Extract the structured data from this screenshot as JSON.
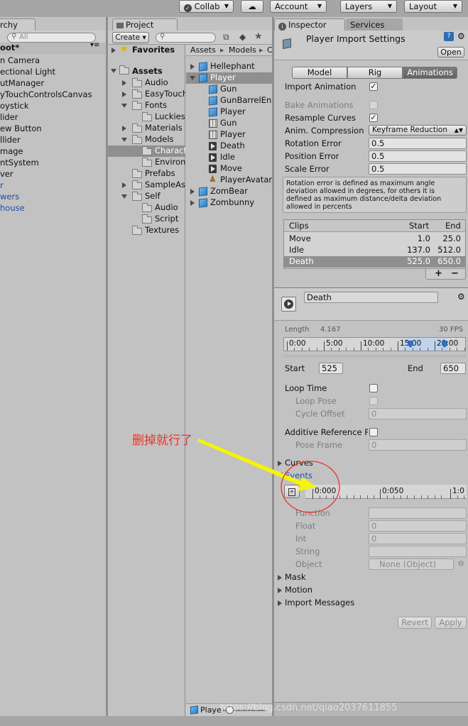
{
  "toolbar": {
    "collab": "Collab",
    "account": "Account",
    "layers": "Layers",
    "layout": "Layout"
  },
  "hierarchy": {
    "tab": "rchy",
    "scene": "oot*",
    "items": [
      "n Camera",
      "ectional Light",
      "utManager",
      "yTouchControlsCanvas",
      "oystick",
      "lider",
      "ew Button",
      "llider",
      "mage",
      "ntSystem",
      "ver",
      "r",
      "wers",
      "house"
    ],
    "blue_items": [
      11,
      12,
      13
    ]
  },
  "project": {
    "tab": "Project",
    "create": "Create",
    "search_placeholder": "",
    "favorites": "Favorites",
    "assets": "Assets",
    "tree": [
      {
        "label": "Audio",
        "depth": 1,
        "arrow": "right"
      },
      {
        "label": "EasyTouch",
        "depth": 1,
        "arrow": "right"
      },
      {
        "label": "Fonts",
        "depth": 1,
        "arrow": "down"
      },
      {
        "label": "Luckiest",
        "depth": 2,
        "arrow": ""
      },
      {
        "label": "Materials",
        "depth": 1,
        "arrow": "right"
      },
      {
        "label": "Models",
        "depth": 1,
        "arrow": "down"
      },
      {
        "label": "Characte",
        "depth": 2,
        "arrow": "",
        "selected": true
      },
      {
        "label": "Environn",
        "depth": 2,
        "arrow": ""
      },
      {
        "label": "Prefabs",
        "depth": 1,
        "arrow": ""
      },
      {
        "label": "SampleAss",
        "depth": 1,
        "arrow": "right"
      },
      {
        "label": "Self",
        "depth": 1,
        "arrow": "down"
      },
      {
        "label": "Audio",
        "depth": 2,
        "arrow": ""
      },
      {
        "label": "Script",
        "depth": 2,
        "arrow": ""
      },
      {
        "label": "Textures",
        "depth": 1,
        "arrow": ""
      }
    ],
    "breadcrumb": [
      "Assets",
      "Models",
      "C"
    ],
    "files": [
      {
        "label": "Hellephant",
        "icon": "cube",
        "depth": 0,
        "arrow": "right"
      },
      {
        "label": "Player",
        "icon": "cube",
        "depth": 0,
        "arrow": "down",
        "selected": true
      },
      {
        "label": "Gun",
        "icon": "cube",
        "depth": 1
      },
      {
        "label": "GunBarrelEn",
        "icon": "cube",
        "depth": 1
      },
      {
        "label": "Player",
        "icon": "cube",
        "depth": 1
      },
      {
        "label": "Gun",
        "icon": "grid",
        "depth": 1
      },
      {
        "label": "Player",
        "icon": "grid",
        "depth": 1
      },
      {
        "label": "Death",
        "icon": "anim",
        "depth": 1
      },
      {
        "label": "Idle",
        "icon": "anim",
        "depth": 1
      },
      {
        "label": "Move",
        "icon": "anim",
        "depth": 1
      },
      {
        "label": "PlayerAvatar",
        "icon": "avatar",
        "depth": 1
      },
      {
        "label": "ZomBear",
        "icon": "cube",
        "depth": 0,
        "arrow": "right"
      },
      {
        "label": "Zombunny",
        "icon": "cube",
        "depth": 0,
        "arrow": "right"
      }
    ],
    "bottom_label": "Playe"
  },
  "inspector": {
    "tab": "Inspector",
    "services_tab": "Services",
    "title": "Player Import Settings",
    "open": "Open",
    "tabs": [
      "Model",
      "Rig",
      "Animations"
    ],
    "active_tab": 2,
    "import_animation": "Import Animation",
    "bake_animations": "Bake Animations",
    "resample_curves": "Resample Curves",
    "anim_compression": "Anim. Compression",
    "compression_value": "Keyframe Reduction",
    "rotation_error": "Rotation Error",
    "rotation_error_value": "0.5",
    "position_error": "Position Error",
    "position_error_value": "0.5",
    "scale_error": "Scale Error",
    "scale_error_value": "0.5",
    "help_text": [
      "Rotation error is defined as maximum angle",
      "deviation allowed in degrees, for others it is",
      "defined as maximum distance/delta deviation",
      "allowed in percents"
    ],
    "clips_header": {
      "name": "Clips",
      "start": "Start",
      "end": "End"
    },
    "clips": [
      {
        "name": "Move",
        "start": "1.0",
        "end": "25.0"
      },
      {
        "name": "Idle",
        "start": "137.0",
        "end": "512.0"
      },
      {
        "name": "Death",
        "start": "525.0",
        "end": "650.0",
        "selected": true
      }
    ],
    "plus": "+",
    "minus": "−",
    "clip_name": "Death",
    "length_label": "Length",
    "length_value": "4.167",
    "fps": "30 FPS",
    "timeline_ticks": [
      "0:00",
      "5:00",
      "10:00",
      "15:00",
      "20:00"
    ],
    "start_label": "Start",
    "start_value": "525",
    "end_label": "End",
    "end_value": "650",
    "loop_time": "Loop Time",
    "loop_pose": "Loop Pose",
    "cycle_offset": "Cycle Offset",
    "cycle_offset_value": "0",
    "additive_ref": "Additive Reference P",
    "pose_frame": "Pose Frame",
    "pose_frame_value": "0",
    "curves": "Curves",
    "events": "Events",
    "events_ticks": [
      "0:000",
      "0:050",
      "1:0"
    ],
    "function": "Function",
    "float": "Float",
    "float_value": "0",
    "int": "Int",
    "int_value": "0",
    "string": "String",
    "object": "Object",
    "object_value": "None (Object)",
    "mask": "Mask",
    "motion": "Motion",
    "import_messages": "Import Messages",
    "revert": "Revert",
    "apply": "Apply"
  },
  "annotation": {
    "text": "删掉就行了",
    "color": "#e8352a",
    "arrow_color": "#f5f500"
  },
  "watermark": "https://blog.csdn.net/qiao2037611855"
}
